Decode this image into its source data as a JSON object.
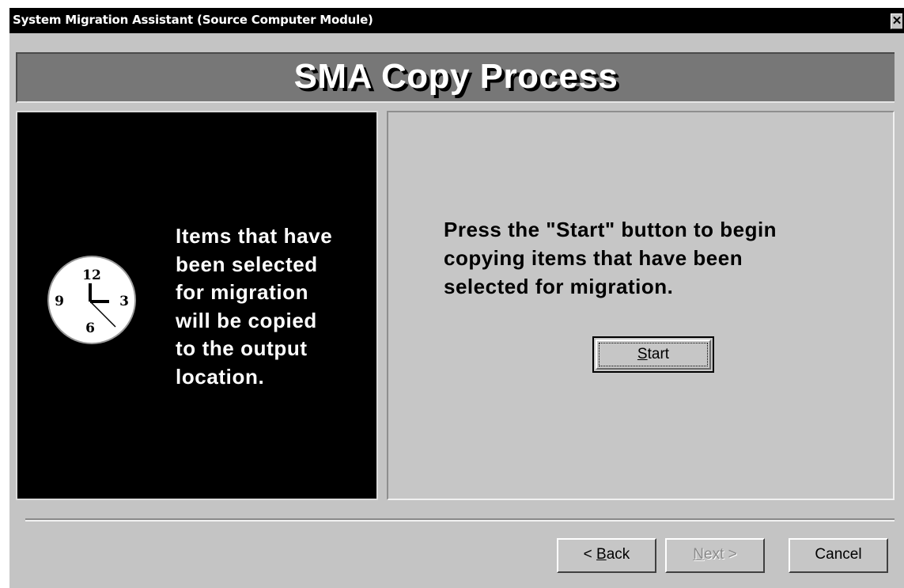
{
  "window": {
    "title": "System Migration Assistant (Source Computer Module)",
    "close_glyph": "✕"
  },
  "banner": {
    "title": "SMA Copy Process"
  },
  "info_panel": {
    "icon": "clock-icon",
    "clock_numbers": [
      "12",
      "3",
      "6",
      "9"
    ],
    "lines": [
      "Items that have",
      "been selected",
      "for migration",
      "will be copied",
      "to the output",
      "location."
    ]
  },
  "action_panel": {
    "lines": [
      "Press the \"Start\" button to begin",
      "copying items that have been",
      "selected for migration."
    ],
    "start_button": {
      "accel": "S",
      "rest": "tart"
    }
  },
  "nav": {
    "back": {
      "prefix": "< ",
      "accel": "B",
      "rest": "ack"
    },
    "next": {
      "accel": "N",
      "rest": "ext >",
      "enabled": false
    },
    "cancel": "Cancel"
  },
  "colors": {
    "window_bg": "#c4c4c4",
    "titlebar_bg": "#000000",
    "banner_bg": "#777777",
    "info_panel_bg": "#000000"
  }
}
